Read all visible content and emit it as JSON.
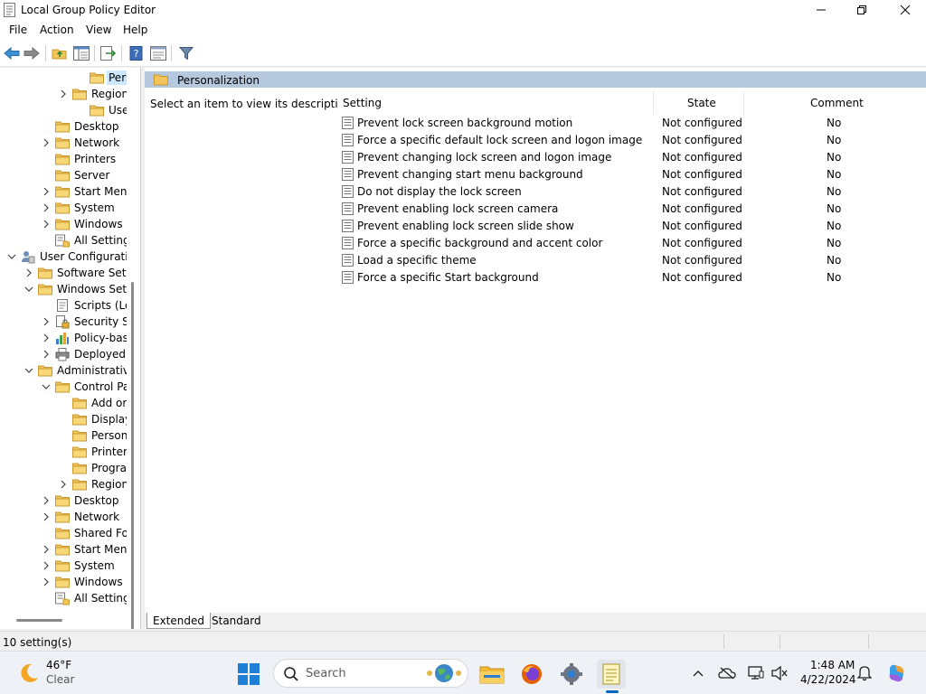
{
  "window": {
    "title": "Local Group Policy Editor"
  },
  "menu": [
    "File",
    "Action",
    "View",
    "Help"
  ],
  "toolbar": {
    "buttons": [
      "back-arrow-icon",
      "forward-arrow-icon",
      "up-folder-icon",
      "show-hide-tree-icon",
      "export-list-icon",
      "help-book-icon",
      "properties-icon",
      "filter-icon"
    ]
  },
  "tree": {
    "items": [
      {
        "label": "Person",
        "icon": "folder-icon",
        "expander": "none",
        "selected": true
      },
      {
        "label": "Region",
        "icon": "folder-icon",
        "expander": "collapsed"
      },
      {
        "label": "User A",
        "icon": "folder-icon",
        "expander": "none"
      },
      {
        "label": "Desktop",
        "icon": "folder-icon",
        "expander": "none"
      },
      {
        "label": "Network",
        "icon": "folder-icon",
        "expander": "collapsed"
      },
      {
        "label": "Printers",
        "icon": "folder-icon",
        "expander": "none"
      },
      {
        "label": "Server",
        "icon": "folder-icon",
        "expander": "none"
      },
      {
        "label": "Start Menu",
        "icon": "folder-icon",
        "expander": "collapsed"
      },
      {
        "label": "System",
        "icon": "folder-icon",
        "expander": "collapsed"
      },
      {
        "label": "Windows (",
        "icon": "folder-icon",
        "expander": "collapsed"
      },
      {
        "label": "All Setting",
        "icon": "all-settings-icon",
        "expander": "none"
      },
      {
        "label": "User Configuratio",
        "icon": "user-config-icon",
        "expander": "expanded"
      },
      {
        "label": "Software Setti",
        "icon": "folder-icon",
        "expander": "collapsed"
      },
      {
        "label": "Windows Sett",
        "icon": "folder-icon",
        "expander": "expanded"
      },
      {
        "label": "Scripts (Lo",
        "icon": "scripts-icon",
        "expander": "none"
      },
      {
        "label": "Security Se",
        "icon": "security-icon",
        "expander": "collapsed"
      },
      {
        "label": "Policy-bas",
        "icon": "policy-chart-icon",
        "expander": "collapsed"
      },
      {
        "label": "Deployed",
        "icon": "printer-icon",
        "expander": "collapsed"
      },
      {
        "label": "Administrative",
        "icon": "folder-icon",
        "expander": "expanded"
      },
      {
        "label": "Control Pa",
        "icon": "folder-icon",
        "expander": "expanded"
      },
      {
        "label": "Add or",
        "icon": "folder-icon",
        "expander": "none"
      },
      {
        "label": "Display",
        "icon": "folder-icon",
        "expander": "none"
      },
      {
        "label": "Person",
        "icon": "folder-icon",
        "expander": "none"
      },
      {
        "label": "Printer",
        "icon": "folder-icon",
        "expander": "none"
      },
      {
        "label": "Progra",
        "icon": "folder-icon",
        "expander": "none"
      },
      {
        "label": "Region",
        "icon": "folder-icon",
        "expander": "collapsed"
      },
      {
        "label": "Desktop",
        "icon": "folder-icon",
        "expander": "collapsed"
      },
      {
        "label": "Network",
        "icon": "folder-icon",
        "expander": "collapsed"
      },
      {
        "label": "Shared Fol",
        "icon": "folder-icon",
        "expander": "none"
      },
      {
        "label": "Start Menu",
        "icon": "folder-icon",
        "expander": "collapsed"
      },
      {
        "label": "System",
        "icon": "folder-icon",
        "expander": "collapsed"
      },
      {
        "label": "Windows (",
        "icon": "folder-icon",
        "expander": "collapsed"
      },
      {
        "label": "All Setting",
        "icon": "all-settings-icon",
        "expander": "none"
      }
    ]
  },
  "details": {
    "header_title": "Personalization",
    "description": "Select an item to view its description.",
    "columns": {
      "setting": "Setting",
      "state": "State",
      "comment": "Comment"
    },
    "rows": [
      {
        "name": "Prevent lock screen background motion",
        "state": "Not configured",
        "comment": "No"
      },
      {
        "name": "Force a specific default lock screen and logon image",
        "state": "Not configured",
        "comment": "No"
      },
      {
        "name": "Prevent changing lock screen and logon image",
        "state": "Not configured",
        "comment": "No"
      },
      {
        "name": "Prevent changing start menu background",
        "state": "Not configured",
        "comment": "No"
      },
      {
        "name": "Do not display the lock screen",
        "state": "Not configured",
        "comment": "No"
      },
      {
        "name": "Prevent enabling lock screen camera",
        "state": "Not configured",
        "comment": "No"
      },
      {
        "name": "Prevent enabling lock screen slide show",
        "state": "Not configured",
        "comment": "No"
      },
      {
        "name": "Force a specific background and accent color",
        "state": "Not configured",
        "comment": "No"
      },
      {
        "name": "Load a specific theme",
        "state": "Not configured",
        "comment": "No"
      },
      {
        "name": "Force a specific Start background",
        "state": "Not configured",
        "comment": "No"
      }
    ],
    "tabs": [
      "Extended",
      "Standard"
    ],
    "active_tab": "Extended"
  },
  "status": {
    "text": "10 setting(s)"
  },
  "taskbar": {
    "weather_temp": "46°F",
    "weather_condition": "Clear",
    "search_placeholder": "Search",
    "apps": [
      "file-explorer-icon",
      "firefox-icon",
      "settings-gear-icon",
      "notepad-icon"
    ],
    "tray": [
      "chevron-up-icon",
      "onedrive-icon",
      "display-icon",
      "speaker-icon"
    ],
    "time": "1:48 AM",
    "date": "4/22/2024"
  },
  "colors": {
    "selection": "#cce8ff",
    "header_band": "#b6c8dd",
    "folder": "#f2c45a",
    "accent": "#0067c0"
  }
}
